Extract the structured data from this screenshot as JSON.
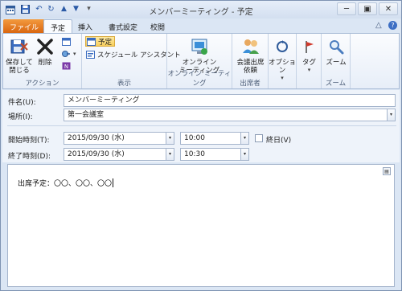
{
  "window": {
    "title": "メンバーミーティング - 予定"
  },
  "quick_access": {
    "icons": [
      "calendar-icon",
      "save-icon",
      "undo-icon",
      "redo-icon",
      "up-arrow-icon",
      "down-arrow-icon",
      "customize-icon"
    ]
  },
  "window_controls": {
    "minimize": "─",
    "restore": "▣",
    "close": "✕"
  },
  "tabs": [
    {
      "label": "ファイル"
    },
    {
      "label": "予定"
    },
    {
      "label": "挿入"
    },
    {
      "label": "書式設定"
    },
    {
      "label": "校閲"
    }
  ],
  "tab_right": {
    "collapse": "△",
    "help": "?"
  },
  "ribbon": {
    "actions": {
      "group_label": "アクション",
      "save_close_label": "保存して\n閉じる",
      "delete_label": "削除"
    },
    "show": {
      "group_label": "表示",
      "appointment_label": "予定",
      "scheduling_label": "スケジュール アシスタント"
    },
    "online_meeting": {
      "group_label": "オンライン ミーティング",
      "online_label": "オンライン\nミーティング"
    },
    "attendees": {
      "group_label": "出席者",
      "invite_label": "会議出席\n依頼"
    },
    "options": {
      "label": "オプション"
    },
    "tags": {
      "label": "タグ"
    },
    "zoom": {
      "group_label": "ズーム",
      "zoom_label": "ズーム"
    }
  },
  "form": {
    "subject_label": "件名(U):",
    "subject_value": "メンバーミーティング",
    "location_label": "場所(I):",
    "location_value": "第一会議室",
    "start_label": "開始時刻(T):",
    "start_date": "2015/09/30 (水)",
    "start_time": "10:00",
    "end_label": "終了時刻(D):",
    "end_date": "2015/09/30 (水)",
    "end_time": "10:30",
    "allday_label": "終日(V)"
  },
  "body": {
    "text": "出席予定：〇〇、〇〇、〇〇"
  }
}
